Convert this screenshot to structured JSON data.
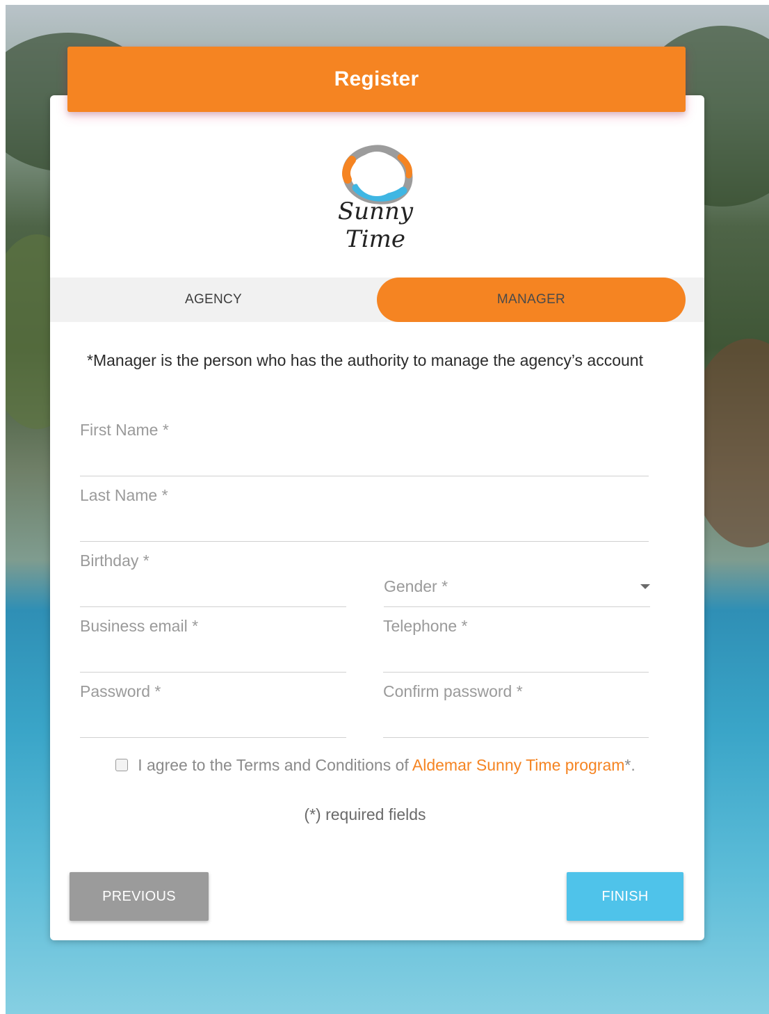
{
  "header": {
    "title": "Register"
  },
  "brand": {
    "logo_text": "Sunny Time"
  },
  "tabs": [
    {
      "label": "AGENCY",
      "active": false
    },
    {
      "label": "MANAGER",
      "active": true
    }
  ],
  "note": "*Manager is the person who has the authority to manage the agency’s account",
  "fields": {
    "first_name": "First Name *",
    "last_name": "Last Name *",
    "birthday": "Birthday *",
    "gender": "Gender *",
    "business_email": "Business email *",
    "telephone": "Telephone *",
    "password": "Password *",
    "confirm_password": "Confirm password *"
  },
  "terms": {
    "prefix": "I agree to the Terms and Conditions of ",
    "link": "Aldemar Sunny Time program",
    "suffix": "*."
  },
  "required_note": "(*) required fields",
  "buttons": {
    "previous": "PREVIOUS",
    "finish": "FINISH"
  },
  "colors": {
    "accent": "#f58422",
    "finish": "#4fc3ea",
    "previous": "#9b9b9b"
  }
}
